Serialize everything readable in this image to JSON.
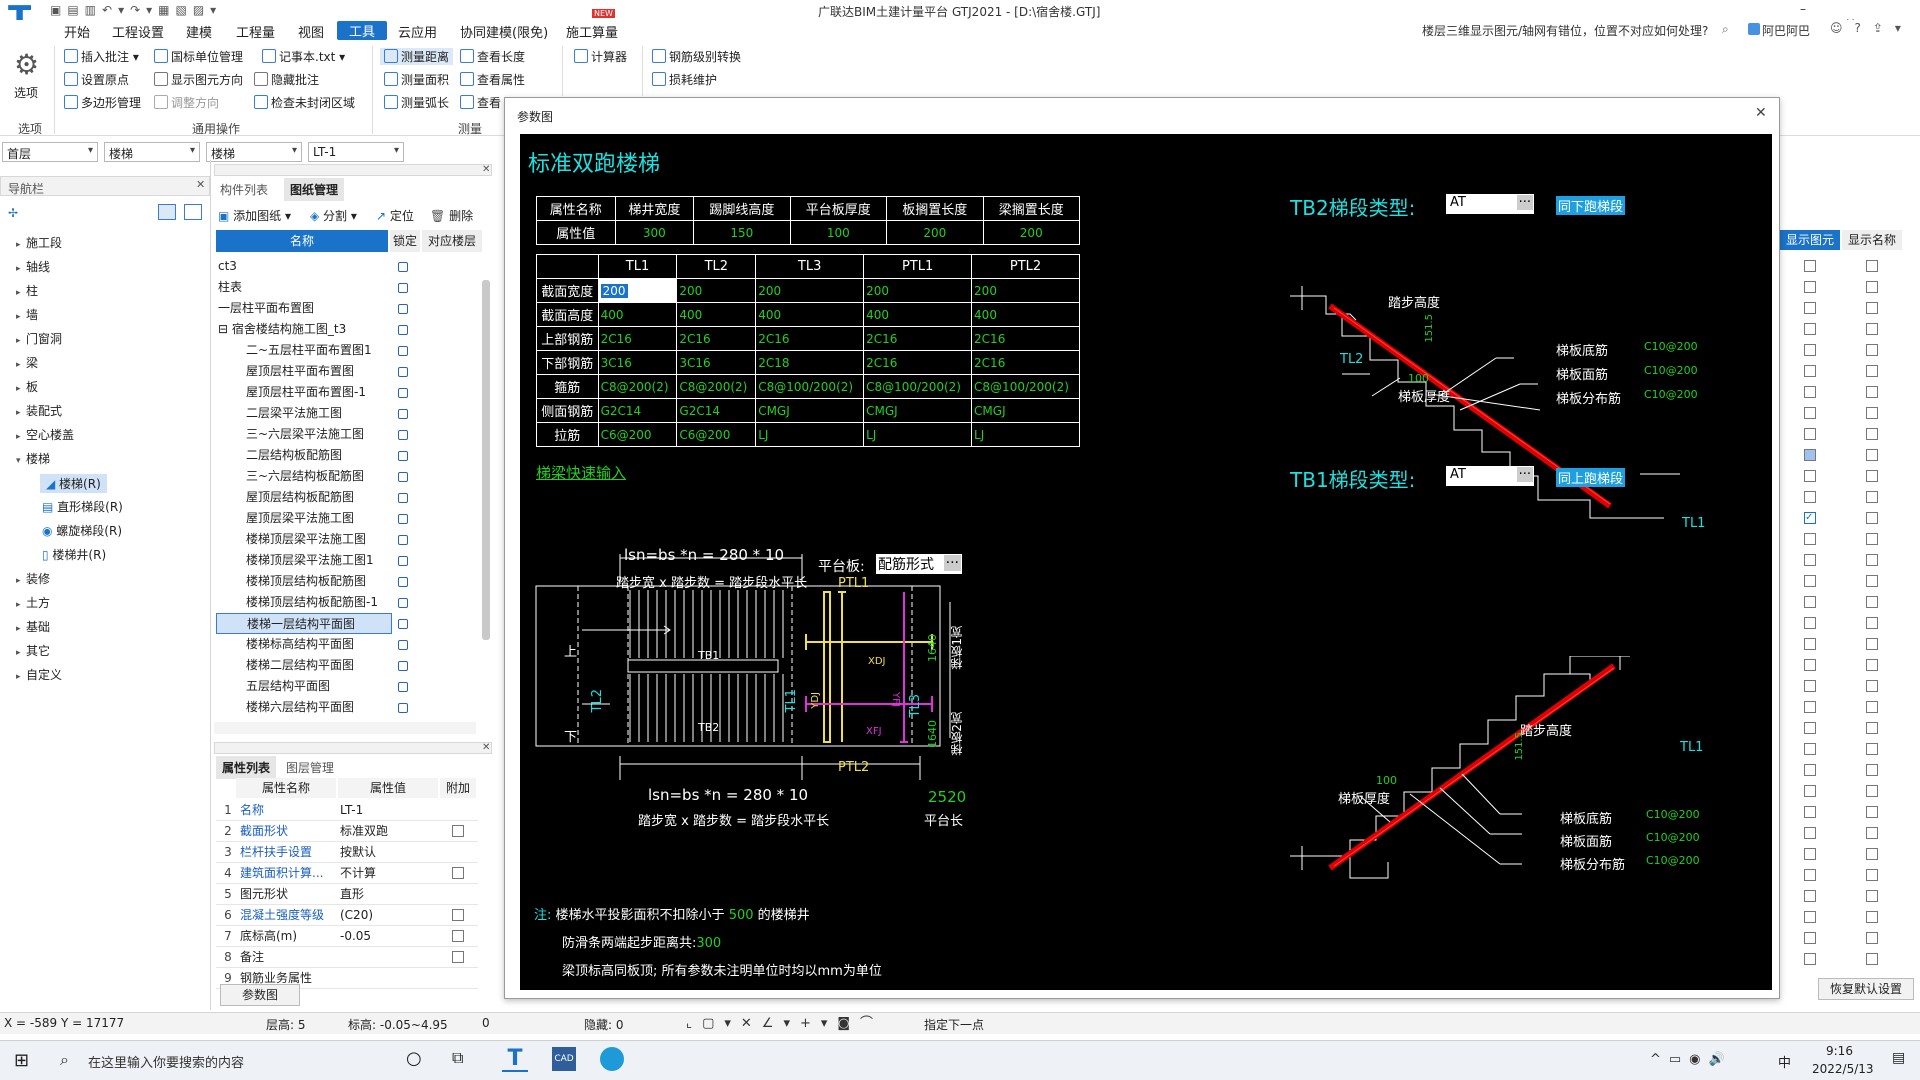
{
  "window": {
    "title": "广联达BIM土建计量平台 GTJ2021 - [D:\\宿舍楼.GTJ]",
    "search_hint": "楼层三维显示图元/轴网有错位，位置不对应如何处理?",
    "user": "阿巴阿巴",
    "new_badge": "NEW"
  },
  "menu": [
    "开始",
    "工程设置",
    "建模",
    "工程量",
    "视图",
    "工具",
    "云应用",
    "协同建模(限免)",
    "施工算量"
  ],
  "ribbon": {
    "options_label": "选项",
    "g1": [
      "插入批注",
      "国标单位管理",
      "记事本.txt",
      "设置原点",
      "显示图元方向",
      "隐藏批注",
      "多边形管理",
      "调整方向",
      "检查未封闭区域"
    ],
    "g1_label": "通用操作",
    "g2": [
      "测量距离",
      "查看长度",
      "测量面积",
      "查看属性",
      "测量弧长",
      "查看"
    ],
    "g2_label": "测量",
    "g3": [
      "计算器"
    ],
    "g4": [
      "钢筋级别转换",
      "损耗维护"
    ],
    "options_group": "选项"
  },
  "selectors": [
    "首层",
    "楼梯",
    "楼梯",
    "LT-1"
  ],
  "nav": {
    "title": "导航栏",
    "items": [
      "施工段",
      "轴线",
      "柱",
      "墙",
      "门窗洞",
      "梁",
      "板",
      "装配式",
      "空心楼盖",
      "楼梯",
      "装修",
      "土方",
      "基础",
      "其它",
      "自定义"
    ],
    "sub": [
      "楼梯(R)",
      "直形梯段(R)",
      "螺旋梯段(R)",
      "楼梯井(R)"
    ]
  },
  "drawing": {
    "tabs": [
      "构件列表",
      "图纸管理"
    ],
    "tools": [
      "添加图纸",
      "分割",
      "定位",
      "删除"
    ],
    "cols": [
      "名称",
      "锁定",
      "对应楼层"
    ],
    "rows": [
      "ct3",
      "柱表",
      "一层柱平面布置图",
      "宿舍楼结构施工图_t3",
      "二~五层柱平面布置图1",
      "屋顶层柱平面布置图",
      "屋顶层柱平面布置图-1",
      "二层梁平法施工图",
      "三~六层梁平法施工图",
      "二层结构板配筋图",
      "三~六层结构板配筋图",
      "屋顶层结构板配筋图",
      "屋顶层梁平法施工图",
      "楼梯顶层梁平法施工图",
      "楼梯顶层梁平法施工图1",
      "楼梯顶层结构板配筋图",
      "楼梯顶层结构板配筋图-1",
      "楼梯一层结构平面图",
      "楼梯标高结构平面图",
      "楼梯二层结构平面图",
      "五层结构平面图",
      "楼梯六层结构平面图"
    ]
  },
  "props": {
    "tabs": [
      "属性列表",
      "图层管理"
    ],
    "cols": [
      "属性名称",
      "属性值",
      "附加"
    ],
    "rows": [
      [
        "1",
        "名称",
        "LT-1"
      ],
      [
        "2",
        "截面形状",
        "标准双跑"
      ],
      [
        "3",
        "栏杆扶手设置",
        "按默认"
      ],
      [
        "4",
        "建筑面积计算...",
        "不计算"
      ],
      [
        "5",
        "图元形状",
        "直形"
      ],
      [
        "6",
        "混凝土强度等级",
        "(C20)"
      ],
      [
        "7",
        "底标高(m)",
        "-0.05"
      ],
      [
        "8",
        "备注",
        ""
      ],
      [
        "9",
        "钢筋业务属性",
        ""
      ]
    ],
    "button": "参数图"
  },
  "right": {
    "cols": [
      "显示图元",
      "显示名称"
    ],
    "button": "恢复默认设置"
  },
  "dialog": {
    "title": "参数图",
    "heading": "标准双跑楼梯",
    "t1": {
      "h": [
        "属性名称",
        "梯井宽度",
        "踢脚线高度",
        "平台板厚度",
        "板搁置长度",
        "梁搁置长度"
      ],
      "v": [
        "属性值",
        "300",
        "150",
        "100",
        "200",
        "200"
      ]
    },
    "t2": {
      "h": [
        "",
        "TL1",
        "TL2",
        "TL3",
        "PTL1",
        "PTL2"
      ],
      "rows": [
        [
          "截面宽度",
          "200",
          "200",
          "200",
          "200",
          "200"
        ],
        [
          "截面高度",
          "400",
          "400",
          "400",
          "400",
          "400"
        ],
        [
          "上部钢筋",
          "2C16",
          "2C16",
          "2C16",
          "2C16",
          "2C16"
        ],
        [
          "下部钢筋",
          "3C16",
          "3C16",
          "2C18",
          "2C16",
          "2C16"
        ],
        [
          "箍筋",
          "C8@200(2)",
          "C8@200(2)",
          "C8@100/200(2)",
          "C8@100/200(2)",
          "C8@100/200(2)"
        ],
        [
          "侧面钢筋",
          "G2C14",
          "G2C14",
          "CMGJ",
          "CMGJ",
          "CMGJ"
        ],
        [
          "拉筋",
          "C6@200",
          "C6@200",
          "LJ",
          "LJ",
          "LJ"
        ]
      ]
    },
    "quick": "梯梁快速输入",
    "plan": {
      "top_formula": "lsn=bs *n = 280 * 10",
      "caption": "踏步宽 x 踏步数 = 踏步段水平长",
      "platform_label": "平台板:",
      "platform_value": "配筋形式",
      "bot_formula": "lsn=bs *n = 280 * 10",
      "bot_caption": "踏步宽 x 踏步数 = 踏步段水平长",
      "width_val": "2520",
      "width_caption": "平台长",
      "up": "上",
      "down": "下",
      "tb1": "TB1",
      "tb2": "TB2",
      "tl1": "TL1",
      "tl2": "TL2",
      "tl3": "TL3",
      "ptl1": "PTL1",
      "ptl2": "PTL2",
      "xdj": "XDJ",
      "ydj": "YDJ",
      "yfj": "YFJ",
      "xfj": "XFJ",
      "d1": "1640",
      "d2": "1640",
      "w1": "梯板1宽",
      "w2": "梯板2宽"
    },
    "tb2": {
      "label": "TB2梯段类型:",
      "type": "AT",
      "link": "同下跑梯段",
      "step": "踏步高度",
      "dim": "151.5",
      "thick": "梯板厚度",
      "v100": "100",
      "r1": "梯板底筋",
      "r2": "梯板面筋",
      "r3": "梯板分布筋",
      "c": "C10@200",
      "tl2": "TL2",
      "tl1": "TL1"
    },
    "tb1": {
      "label": "TB1梯段类型:",
      "type": "AT",
      "link": "同上跑梯段",
      "step": "踏步高度",
      "dim": "151.5",
      "thick": "梯板厚度",
      "v100": "100",
      "r1": "梯板底筋",
      "r2": "梯板面筋",
      "r3": "梯板分布筋",
      "c": "C10@200",
      "tl1": "TL1"
    },
    "notes": {
      "n1a": "注:",
      "n1b": "楼梯水平投影面积不扣除小于",
      "n1c": "500",
      "n1d": "的楼梯井",
      "n2a": "防滑条两端起步距离共:",
      "n2b": "300",
      "n3": "梁顶标高同板顶; 所有参数未注明单位时均以mm为单位"
    }
  },
  "status": {
    "coords": "X = -589 Y = 17177",
    "floor_h": "层高:  5",
    "elev": "标高:  -0.05~4.95",
    "zero": "0",
    "hidden": "隐藏:  0",
    "next": "指定下一点"
  },
  "taskbar": {
    "search": "在这里输入你要搜索的内容",
    "time": "9:16",
    "date": "2022/5/13",
    "ime": "中"
  }
}
